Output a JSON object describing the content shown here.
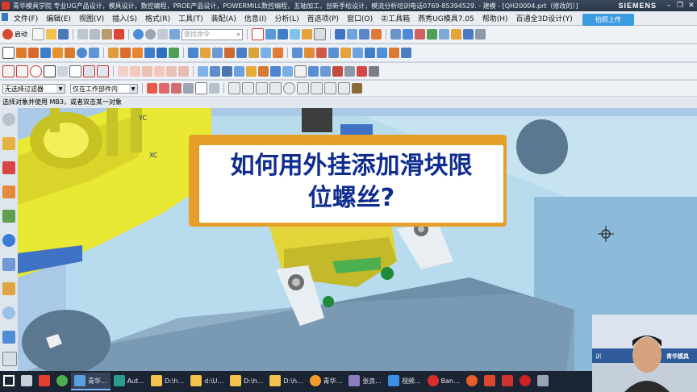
{
  "window": {
    "title": "青华模具学院 专业UG产品设计，模具设计，数控编程，PROE产品设计，POWERMILL数控编程，五轴加工，创新手绘设计，模流分析培训电话0769-85394529. - 建模 - [QH20004.prt（修改的）]",
    "brand": "SIEMENS"
  },
  "menu": {
    "items": [
      "文件(F)",
      "编辑(E)",
      "视图(V)",
      "插入(S)",
      "格式(R)",
      "工具(T)",
      "装配(A)",
      "信息(I)",
      "分析(L)",
      "首选项(P)",
      "窗口(O)",
      "㊣工具箱",
      "燕秀UG模具7.05",
      "帮助(H)",
      "百通全3D设计(Y)"
    ],
    "upload_label": "拍照上传"
  },
  "toolbar": {
    "start_label": "启动",
    "search_placeholder": "查找命令"
  },
  "selection": {
    "filter_value": "无选择过滤器",
    "scope_value": "仅在工作部件内"
  },
  "status": {
    "prompt": "选择对象并使用 MB3，或者双击某一对象"
  },
  "viewport": {
    "axis_labels": [
      "YC",
      "XC"
    ],
    "overlay_lines": [
      "如何用外挂添加滑块限",
      "位螺丝?"
    ]
  },
  "webcam": {
    "sign_text": "青华模具",
    "sign_left": "训"
  },
  "taskbar": {
    "items": [
      {
        "label": "",
        "icon": "windows-start-icon",
        "color": "#ffffff"
      },
      {
        "label": "",
        "icon": "task-view-icon",
        "color": "#c8d0dc"
      },
      {
        "label": "",
        "icon": "browser-icon",
        "color": "#e43f2f"
      },
      {
        "label": "",
        "icon": "chrome-icon",
        "color": "#4caf50"
      },
      {
        "label": "青华...",
        "icon": "nx-icon",
        "color": "#5aa0e0",
        "active": true
      },
      {
        "label": "Aut...",
        "icon": "autocad-icon",
        "color": "#2a9d8f"
      },
      {
        "label": "D:\\h...",
        "icon": "folder-icon",
        "color": "#f2c14e"
      },
      {
        "label": "d:\\U...",
        "icon": "folder-icon",
        "color": "#f2c14e"
      },
      {
        "label": "D:\\h...",
        "icon": "folder-icon",
        "color": "#f2c14e"
      },
      {
        "label": "D:\\h...",
        "icon": "folder-icon",
        "color": "#f2c14e"
      },
      {
        "label": "青华...",
        "icon": "chat-icon",
        "color": "#f29a2e"
      },
      {
        "label": "张良...",
        "icon": "user-icon",
        "color": "#8e7cc3"
      },
      {
        "label": "视频...",
        "icon": "video-icon",
        "color": "#3a8ee6"
      },
      {
        "label": "Ban...",
        "icon": "record-icon",
        "color": "#d62d2d"
      },
      {
        "label": "",
        "icon": "app-s-icon",
        "color": "#e85d2b"
      },
      {
        "label": "",
        "icon": "app-grid-icon",
        "color": "#d9482f"
      },
      {
        "label": "",
        "icon": "app-p-icon",
        "color": "#cf3030"
      },
      {
        "label": "",
        "icon": "record-dot-icon",
        "color": "#cc2222"
      },
      {
        "label": "",
        "icon": "app-tray-icon",
        "color": "#9aa6b5"
      }
    ]
  },
  "colors": {
    "overlay_border": "#e6a02a",
    "overlay_text": "#0f2c8f",
    "viewport_bg": "#a9c9e6",
    "titlebar": "#2f3c4f",
    "taskbar": "#1b2433"
  }
}
